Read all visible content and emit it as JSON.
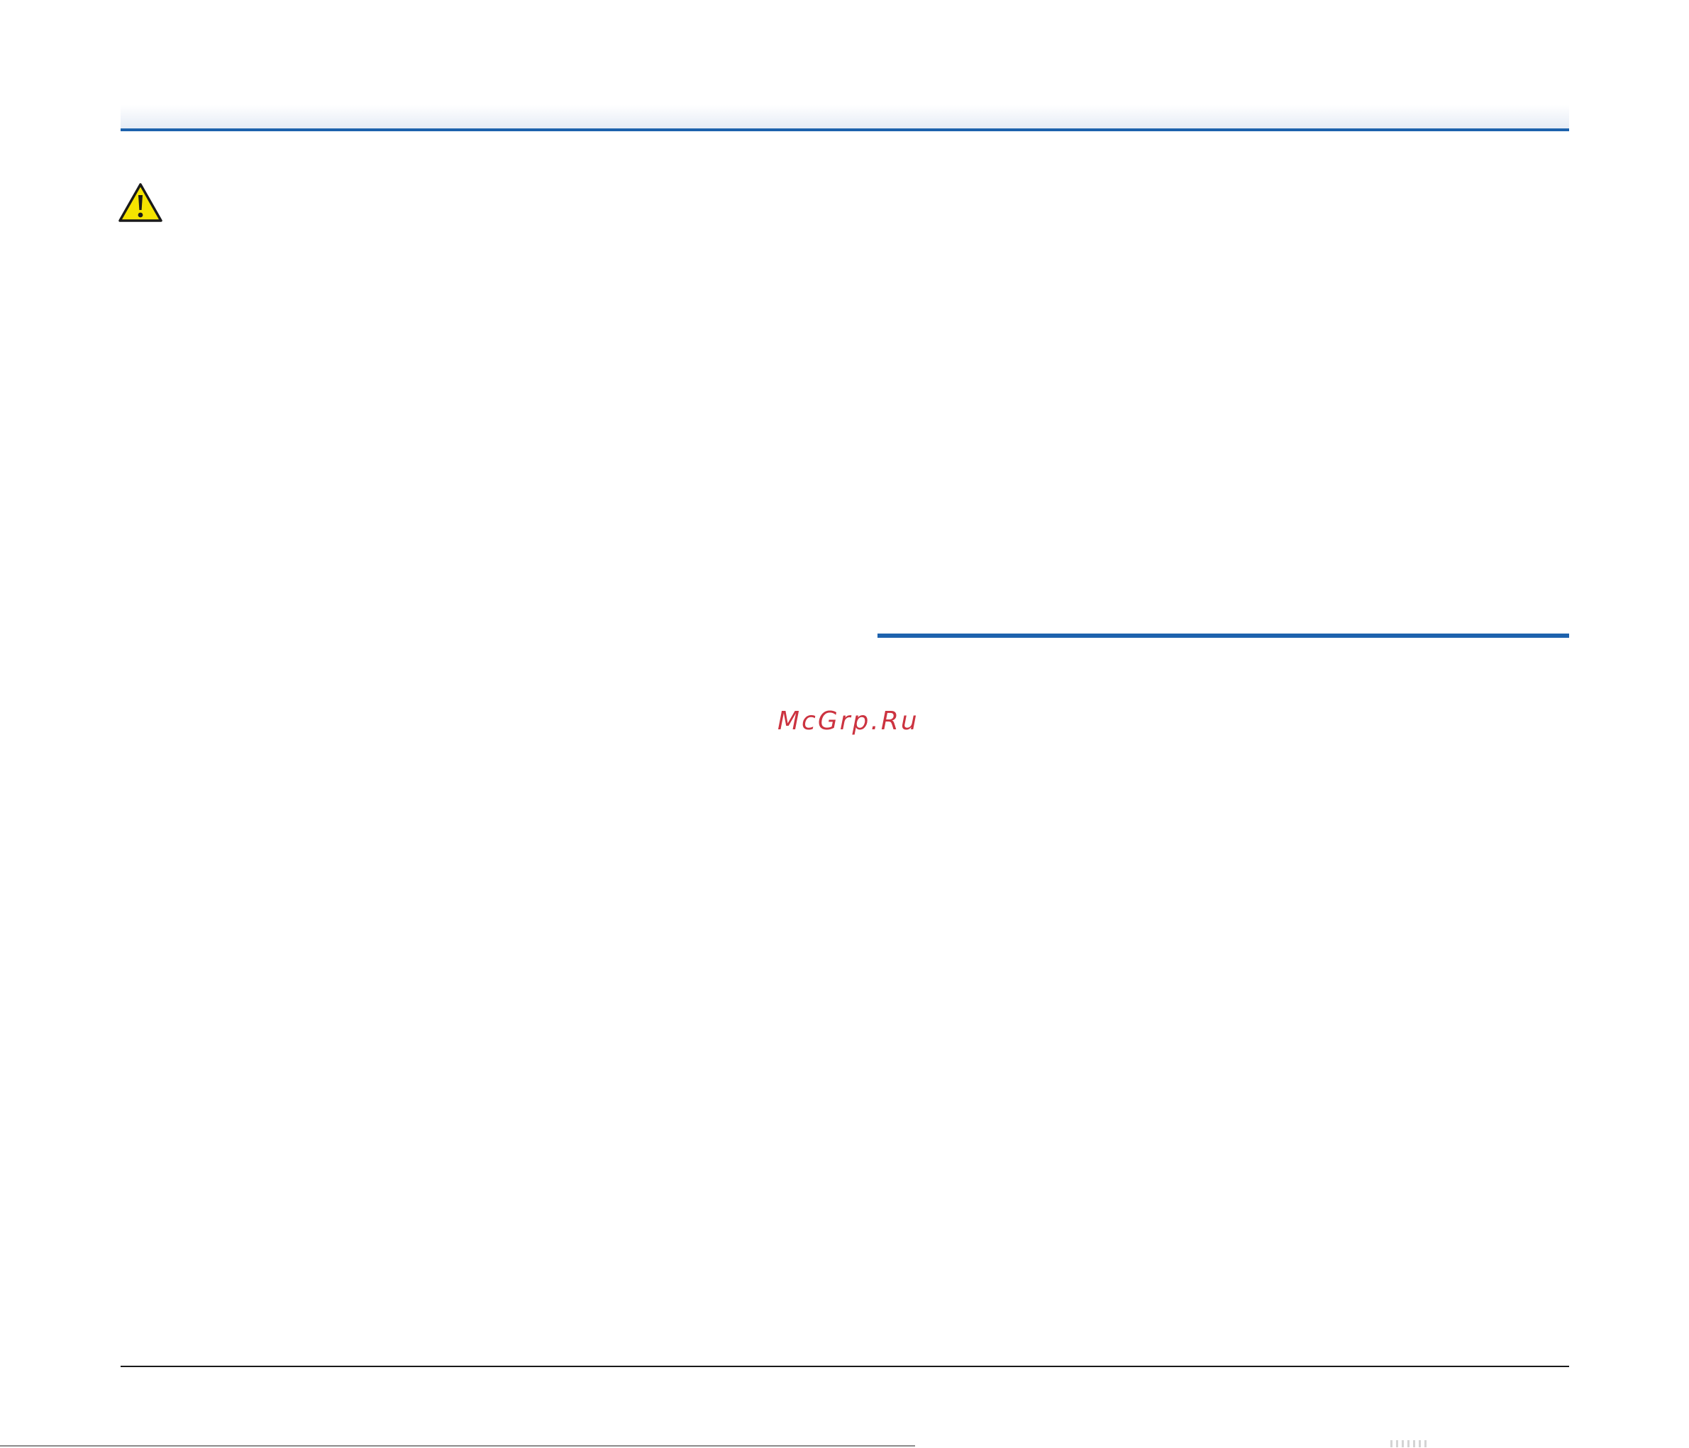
{
  "watermark": {
    "text": "McGrp.Ru",
    "color": "#cc3340"
  },
  "icons": {
    "warning": "warning-triangle-icon"
  },
  "colors": {
    "accent_rule": "#1d62ad",
    "warning_fill": "#f5e400",
    "footer_rule": "#1a1a1a"
  }
}
